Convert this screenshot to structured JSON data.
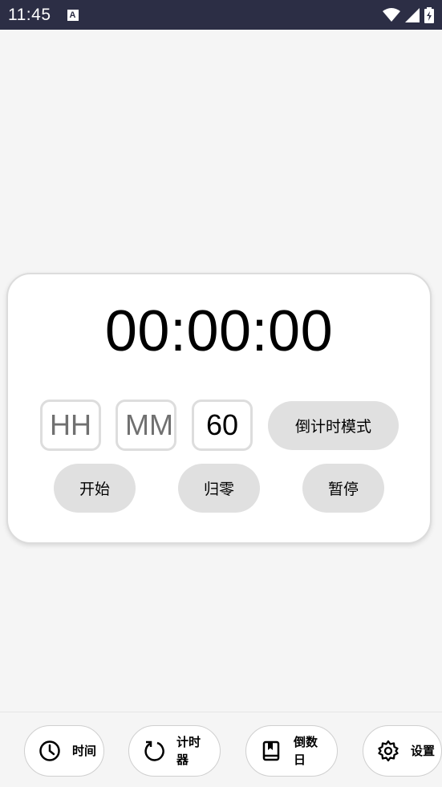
{
  "status_bar": {
    "time": "11:45",
    "notification_icon": "A",
    "icons": [
      "wifi-icon",
      "signal-icon",
      "battery-icon"
    ]
  },
  "timer": {
    "display": "00:00:00",
    "hours_placeholder": "HH",
    "minutes_placeholder": "MM",
    "seconds_value": "60",
    "mode_label": "倒计时模式",
    "start_label": "开始",
    "reset_label": "归零",
    "pause_label": "暂停"
  },
  "bottom_nav": {
    "items": [
      {
        "label": "时间",
        "icon": "clock-icon"
      },
      {
        "label": "计时器",
        "icon": "refresh-icon"
      },
      {
        "label": "倒数日",
        "icon": "book-icon"
      },
      {
        "label": "设置",
        "icon": "gear-icon"
      }
    ]
  },
  "colors": {
    "status_bar": "#2c2e45",
    "background": "#f5f5f5",
    "button": "#e0e0e0"
  }
}
